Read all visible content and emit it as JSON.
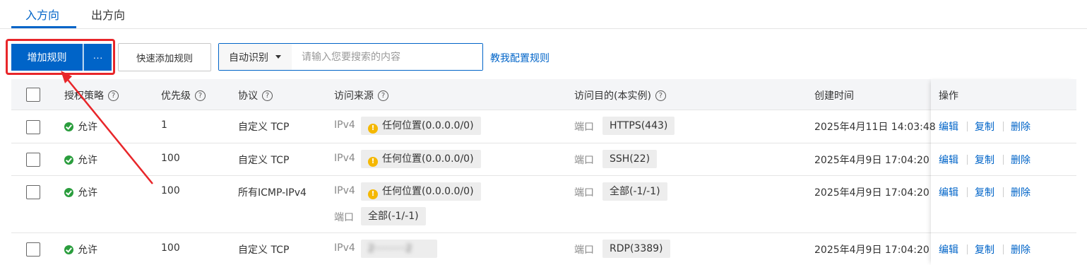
{
  "tabs": [
    {
      "label": "入方向",
      "active": true
    },
    {
      "label": "出方向",
      "active": false
    }
  ],
  "toolbar": {
    "add_rule": "增加规则",
    "more": "···",
    "quick_add": "快速添加规则",
    "search_select": "自动识别",
    "search_placeholder": "请输入您要搜索的内容",
    "teach_link": "教我配置规则"
  },
  "table": {
    "headers": {
      "policy": "授权策略",
      "priority": "优先级",
      "protocol": "协议",
      "source": "访问来源",
      "destination": "访问目的(本实例)",
      "created": "创建时间",
      "ops": "操作"
    },
    "rows": [
      {
        "policy": "允许",
        "priority": "1",
        "protocol": "自定义 TCP",
        "src_label": "IPv4",
        "src_value": "任何位置(0.0.0.0/0)",
        "dst_label": "端口",
        "dst_value": "HTTPS(443)",
        "created": "2025年4月11日 14:03:48"
      },
      {
        "policy": "允许",
        "priority": "100",
        "protocol": "自定义 TCP",
        "src_label": "IPv4",
        "src_value": "任何位置(0.0.0.0/0)",
        "dst_label": "端口",
        "dst_value": "SSH(22)",
        "created": "2025年4月9日 17:04:20"
      },
      {
        "policy": "允许",
        "priority": "100",
        "protocol": "所有ICMP-IPv4",
        "src_label": "IPv4",
        "src_value": "任何位置(0.0.0.0/0)",
        "src2_label": "端口",
        "src2_value": "全部(-1/-1)",
        "dst_label": "端口",
        "dst_value": "全部(-1/-1)",
        "created": "2025年4月9日 17:04:20"
      },
      {
        "policy": "允许",
        "priority": "100",
        "protocol": "自定义 TCP",
        "src_label": "IPv4",
        "src_value": "2··········2",
        "dst_label": "端口",
        "dst_value": "RDP(3389)",
        "created": "2025年4月9日 17:04:20"
      }
    ],
    "ops": {
      "edit": "编辑",
      "copy": "复制",
      "delete": "删除"
    }
  },
  "colors": {
    "primary": "#0064c8",
    "highlight": "#e8262a",
    "allow": "#2a9d3d",
    "warning": "#f5b800"
  }
}
